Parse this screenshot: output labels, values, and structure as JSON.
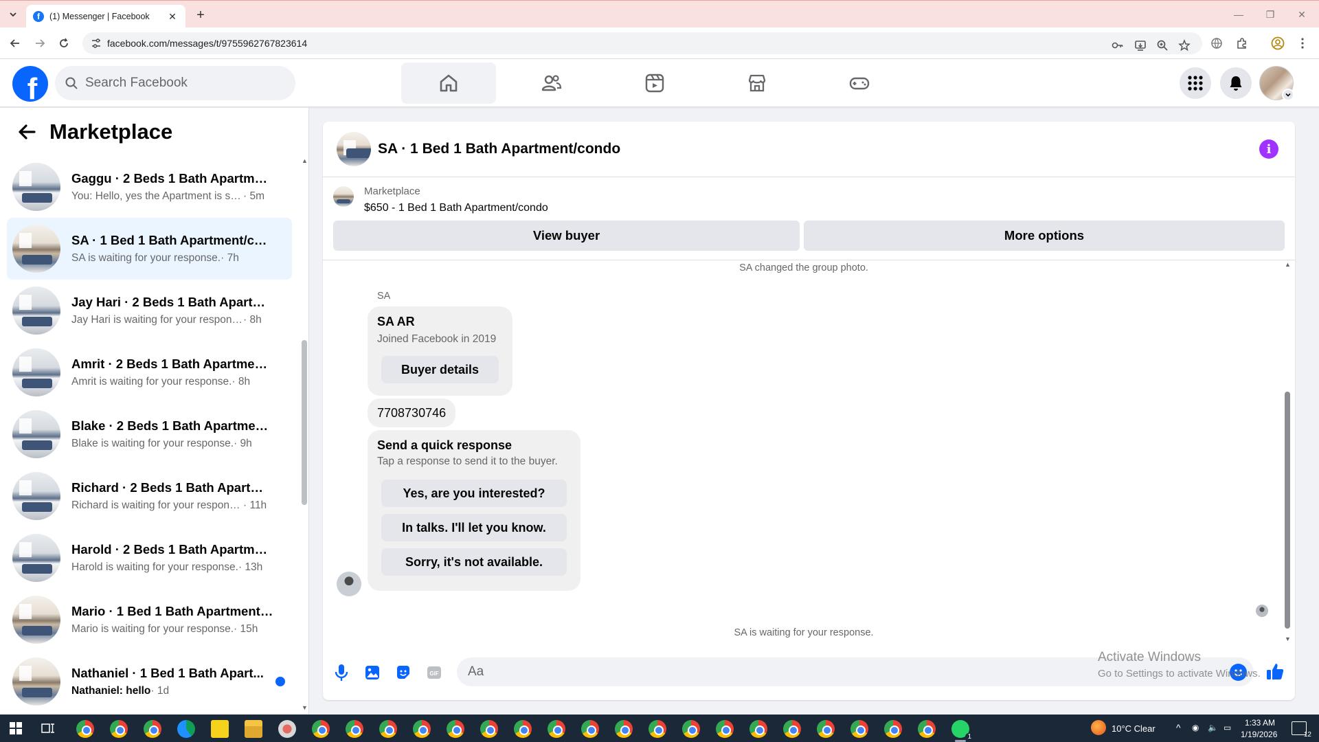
{
  "browser": {
    "tab_title": "(1) Messenger | Facebook",
    "url": "facebook.com/messages/t/9755962767823614"
  },
  "header": {
    "search_placeholder": "Search Facebook",
    "nav_icons": [
      "home-icon",
      "friends-icon",
      "video-icon",
      "marketplace-icon",
      "gaming-icon"
    ],
    "right_icons": [
      "menu-grid-icon",
      "notifications-bell-icon",
      "profile-avatar"
    ]
  },
  "sidebar": {
    "title": "Marketplace",
    "conversations": [
      {
        "name": "Gaggu · 2 Beds 1 Bath Apartmen...",
        "snippet": "You: Hello, yes the Apartment is stil...",
        "time": " · 5m",
        "active": false,
        "unread": false
      },
      {
        "name": "SA · 1 Bed 1 Bath Apartment/con...",
        "snippet": "SA is waiting for your response.",
        "time": " · 7h",
        "active": true,
        "unread": false
      },
      {
        "name": "Jay Hari · 2 Beds 1 Bath Apartme...",
        "snippet": "Jay Hari is waiting for your response.",
        "time": " · 8h",
        "active": false,
        "unread": false
      },
      {
        "name": "Amrit · 2 Beds 1 Bath Apartment...",
        "snippet": "Amrit is waiting for your response.",
        "time": " · 8h",
        "active": false,
        "unread": false
      },
      {
        "name": "Blake · 2 Beds 1 Bath Apartment/...",
        "snippet": "Blake is waiting for your response.",
        "time": " · 9h",
        "active": false,
        "unread": false
      },
      {
        "name": "Richard · 2 Beds 1 Bath Apartme...",
        "snippet": "Richard is waiting for your respons...",
        "time": " · 11h",
        "active": false,
        "unread": false
      },
      {
        "name": "Harold · 2 Beds 1 Bath Apartmen...",
        "snippet": "Harold is waiting for your response.",
        "time": " · 13h",
        "active": false,
        "unread": false
      },
      {
        "name": "Mario · 1 Bed 1 Bath Apartment/...",
        "snippet": "Mario is waiting for your response.",
        "time": " · 15h",
        "active": false,
        "unread": false
      },
      {
        "name": "Nathaniel · 1 Bed 1 Bath Apart...",
        "snippet": "Nathaniel: hello",
        "time": " · 1d",
        "active": false,
        "unread": true
      }
    ]
  },
  "chat": {
    "title": "SA · 1 Bed 1 Bath Apartment/condo",
    "listing_label": "Marketplace",
    "listing_price": "$650 - 1 Bed 1 Bath Apartment/condo",
    "view_buyer": "View buyer",
    "more_options": "More options",
    "system_top": "SA changed the group photo.",
    "sender": "SA",
    "profile_card": {
      "name": "SA AR",
      "joined": "Joined Facebook in 2019",
      "button": "Buyer details"
    },
    "phone_message": "7708730746",
    "quick_response": {
      "title": "Send a quick response",
      "subtitle": "Tap a response to send it to the buyer.",
      "options": [
        "Yes, are you interested?",
        "In talks. I'll let you know.",
        "Sorry, it's not available."
      ]
    },
    "system_bottom": "SA is waiting for your response.",
    "composer_placeholder": "Aa"
  },
  "watermark": {
    "line1": "Activate Windows",
    "line2": "Go to Settings to activate Windows."
  },
  "taskbar": {
    "weather": "10°C  Clear",
    "time": "1:33 AM",
    "date": "1/19/2026",
    "whatsapp_badge": "1",
    "notification_badge": "12"
  },
  "colors": {
    "facebook_blue": "#0866ff",
    "active_conversation": "#ebf5ff",
    "info_purple": "#a033ff",
    "tabbar_bg": "#f8e1df",
    "taskbar_bg": "#1b2838"
  }
}
